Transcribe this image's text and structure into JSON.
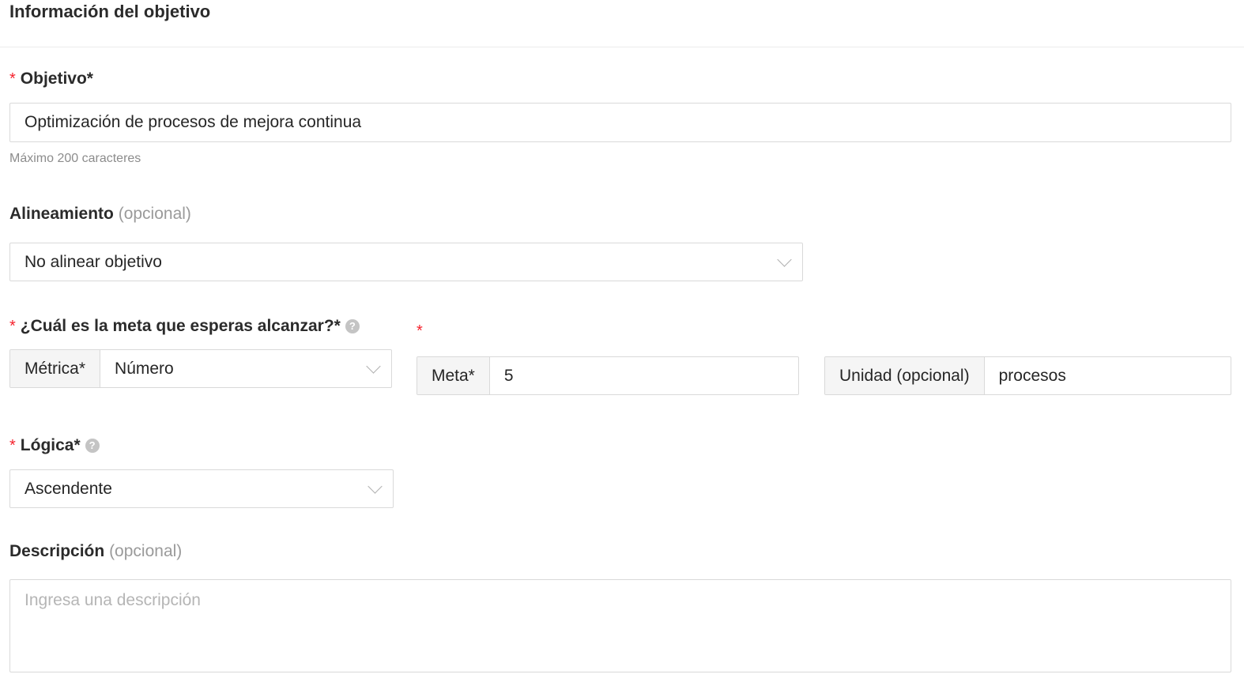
{
  "section_title": "Información del objetivo",
  "objective": {
    "label": "Objetivo*",
    "value": "Optimización de procesos de mejora continua",
    "hint": "Máximo 200 caracteres"
  },
  "alignment": {
    "label": "Alineamiento",
    "optional": "(opcional)",
    "selected": "No alinear objetivo"
  },
  "goal": {
    "label": "¿Cuál es la meta que esperas alcanzar?*",
    "metric_addon": "Métrica*",
    "metric_selected": "Número",
    "meta_addon": "Meta*",
    "meta_value": "5",
    "unit_addon": "Unidad (opcional)",
    "unit_value": "procesos"
  },
  "logic": {
    "label": "Lógica*",
    "selected": "Ascendente"
  },
  "description": {
    "label": "Descripción",
    "optional": "(opcional)",
    "placeholder": "Ingresa una descripción"
  },
  "icons": {
    "required": "*",
    "help": "?"
  }
}
